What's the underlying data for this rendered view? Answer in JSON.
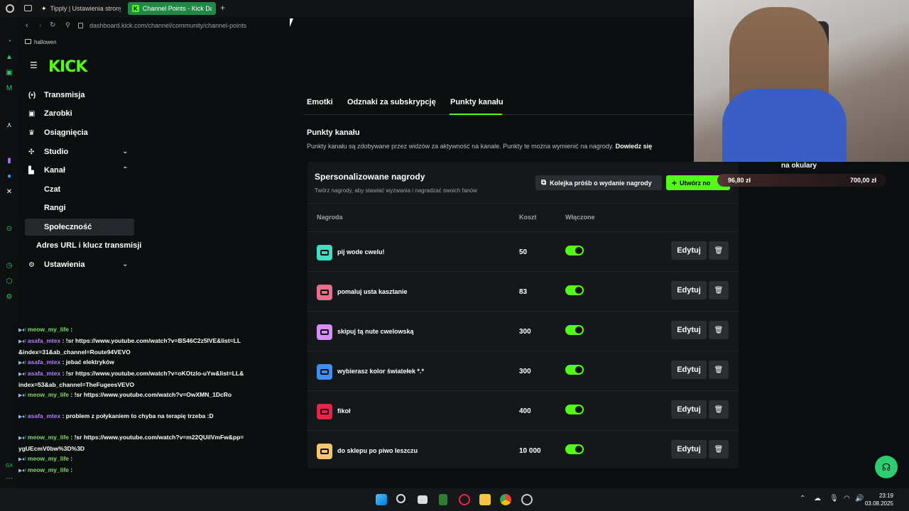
{
  "browser": {
    "tabs": [
      {
        "title": "Tipply | Ustawienia strony"
      },
      {
        "title": "Channel Points - Kick Da"
      }
    ],
    "url": "dashboard.kick.com/channel/community/channel-points",
    "bookmark": "hallowen"
  },
  "sidebar": {
    "logo": "KICK",
    "items": [
      {
        "label": "Transmisja"
      },
      {
        "label": "Zarobki"
      },
      {
        "label": "Osiągnięcia"
      },
      {
        "label": "Studio"
      },
      {
        "label": "Kanał"
      },
      {
        "label": "Czat"
      },
      {
        "label": "Rangi"
      },
      {
        "label": "Społeczność"
      },
      {
        "label": "Adres URL i klucz transmisji"
      },
      {
        "label": "Ustawienia"
      }
    ]
  },
  "main": {
    "tabs": [
      {
        "label": "Emotki"
      },
      {
        "label": "Odznaki za subskrypcję"
      },
      {
        "label": "Punkty kanału"
      }
    ],
    "section_title": "Punkty kanału",
    "section_desc": "Punkty kanału są zdobywane przez widzów za aktywność na kanale. Punkty te można wymienić na nagrody.",
    "section_link": "Dowiedz się",
    "panel": {
      "title": "Spersonalizowane nagrody",
      "subtitle": "Twórz nagrody, aby stawiać wyzwania i nagradzać swoich fanów",
      "queue_button": "Kolejka próśb o wydanie nagrody",
      "create_button": "Utwórz no",
      "columns": {
        "reward": "Nagroda",
        "cost": "Koszt",
        "enabled": "Włączone"
      },
      "edit_label": "Edytuj",
      "rewards": [
        {
          "name": "pij wode cwelu!",
          "cost": "50",
          "color": "#3de0c0"
        },
        {
          "name": "pomaluj usta kasztanie",
          "cost": "83",
          "color": "#f06a8a"
        },
        {
          "name": "skipuj tą nute cwelowską",
          "cost": "300",
          "color": "#d78ef7"
        },
        {
          "name": "wybierasz kolor światełek *.*",
          "cost": "300",
          "color": "#3d8ef7"
        },
        {
          "name": "fikoł",
          "cost": "400",
          "color": "#e0264a"
        },
        {
          "name": "do sklepu po piwo leszczu",
          "cost": "10 000",
          "color": "#f7c56a"
        }
      ]
    }
  },
  "overlay": {
    "goal_title": "na okulary",
    "goal_current": "96,80 zł",
    "goal_max": "700,00 zł"
  },
  "chat": [
    {
      "user": "meow_my_life",
      "color": "u1",
      "text": ":"
    },
    {
      "user": "asafa_mtex",
      "color": "u2",
      "text": ": !sr https://www.youtube.com/watch?v=BS46C2z5lVE&list=LL&index=31&ab_channel=Route94VEVO"
    },
    {
      "user": "asafa_mtex",
      "color": "u2",
      "text": ": jebać elektryków"
    },
    {
      "user": "asafa_mtex",
      "color": "u2",
      "text": ": !sr https://www.youtube.com/watch?v=oKOtzlo-uYw&list=LL&index=53&ab_channel=TheFugeesVEVO"
    },
    {
      "user": "meow_my_life",
      "color": "u1",
      "text": ": !sr https://www.youtube.com/watch?v=OwXMN_1DcRo"
    },
    {
      "user": "asafa_mtex",
      "color": "u2",
      "text": ": problem z połykaniem   to chyba na terapię trzeba :D"
    },
    {
      "user": "meow_my_life",
      "color": "u1",
      "text": ": !sr https://www.youtube.com/watch?v=m22QUilVmFw&pp=ygUEcmV0bw%3D%3D"
    },
    {
      "user": "meow_my_life",
      "color": "u1",
      "text": ":"
    },
    {
      "user": "meow_my_life",
      "color": "u1",
      "text": ":"
    }
  ],
  "taskbar": {
    "time": "23:19",
    "date": "03.08.2025"
  }
}
